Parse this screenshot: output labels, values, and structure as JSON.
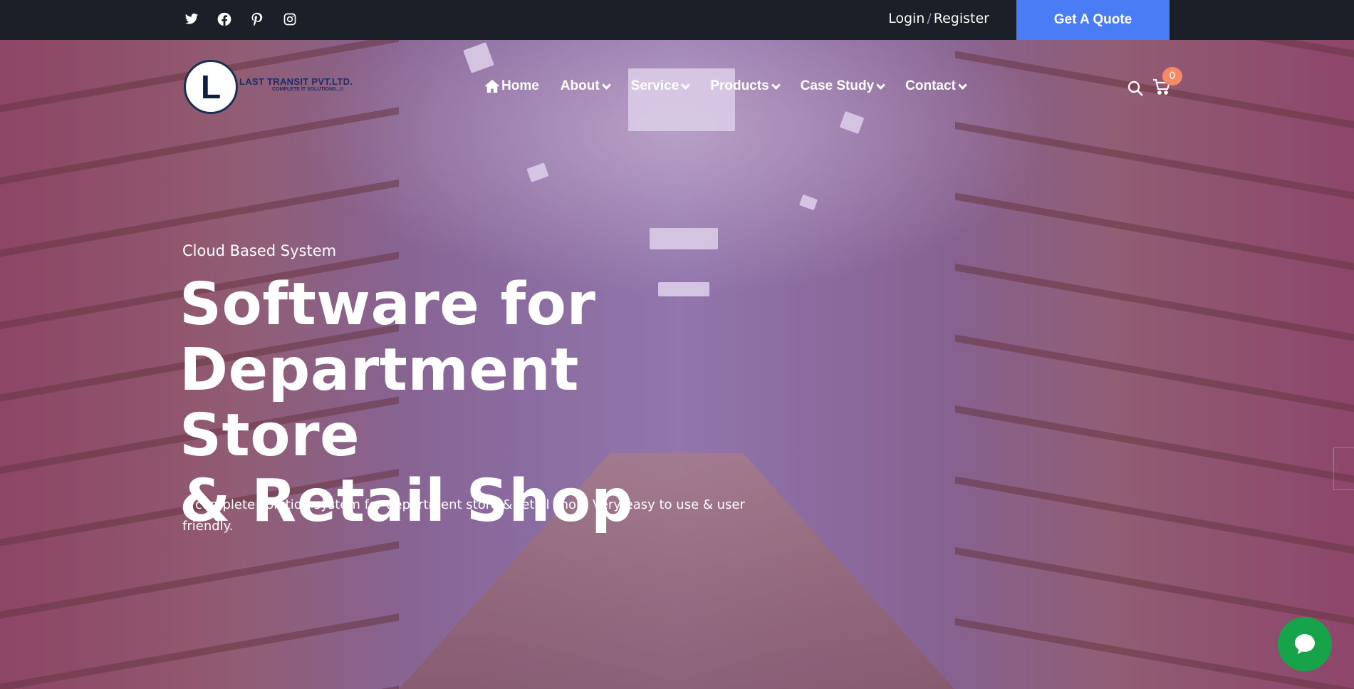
{
  "topbar": {
    "social": [
      {
        "icon": "twitter-icon"
      },
      {
        "icon": "facebook-icon"
      },
      {
        "icon": "pinterest-icon"
      },
      {
        "icon": "instagram-icon"
      }
    ],
    "login_label": "Login",
    "separator": "/",
    "register_label": "Register",
    "quote_label": "Get A Quote"
  },
  "header": {
    "logo": {
      "letter": "L",
      "name": "LAST TRANSIT PVT.LTD.",
      "tagline": "COMPLETE IT SOLUTIONS...!!"
    },
    "nav": [
      {
        "label": "Home",
        "icon": "home-icon"
      },
      {
        "label": "About",
        "dropdown": true
      },
      {
        "label": "Service",
        "dropdown": true
      },
      {
        "label": "Products",
        "dropdown": true
      },
      {
        "label": "Case Study",
        "dropdown": true
      },
      {
        "label": "Contact",
        "dropdown": true
      }
    ],
    "cart_count": "0"
  },
  "hero": {
    "eyebrow": "Cloud Based System",
    "headline_line1": "Software for",
    "headline_line2": "Department Store",
    "headline_line3": "& Retail Shop",
    "subtext": "A complete solution system for department store & retail shop. Very easy to use & user friendly."
  },
  "colors": {
    "topbar_bg": "#1b1f27",
    "accent": "#4a7cf6",
    "badge": "#f48a65",
    "chat": "#17a34a",
    "overlay": "#4628967a"
  }
}
